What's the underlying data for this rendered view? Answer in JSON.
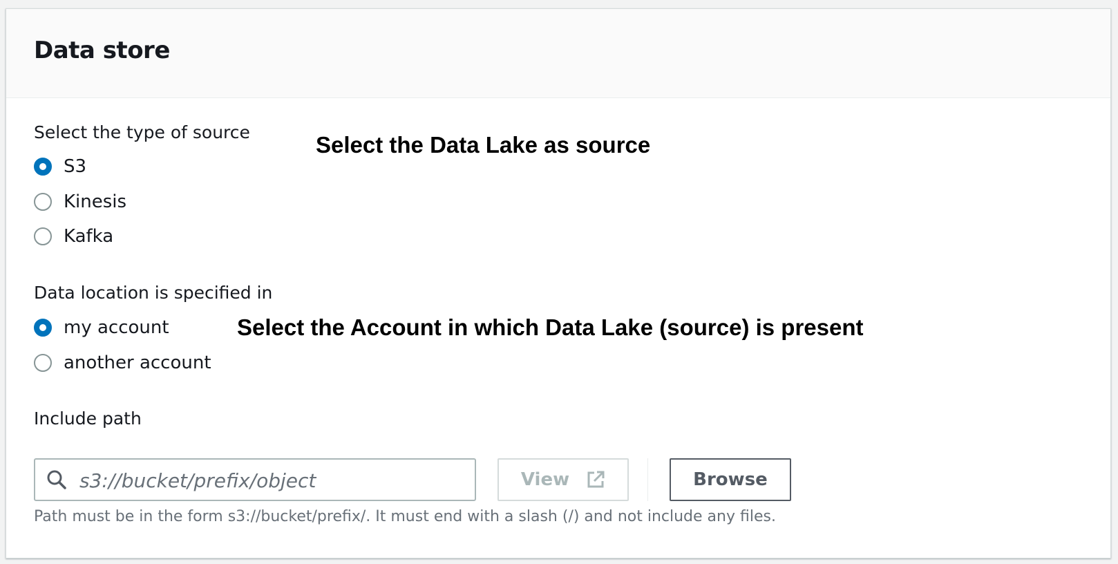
{
  "panel": {
    "title": "Data store"
  },
  "source_type": {
    "label": "Select the type of source",
    "options": [
      {
        "label": "S3",
        "selected": true
      },
      {
        "label": "Kinesis",
        "selected": false
      },
      {
        "label": "Kafka",
        "selected": false
      }
    ]
  },
  "data_location": {
    "label": "Data location is specified in",
    "options": [
      {
        "label": "my account",
        "selected": true
      },
      {
        "label": "another account",
        "selected": false
      }
    ]
  },
  "annotations": {
    "source_note": "Select the Data Lake as source",
    "account_note": "Select the Account in which Data Lake (source) is present"
  },
  "include_path": {
    "label": "Include path",
    "placeholder": "s3://bucket/prefix/object",
    "value": "",
    "view_label": "View",
    "browse_label": "Browse",
    "hint": "Path must be in the form s3://bucket/prefix/. It must end with a slash (/) and not include any files."
  },
  "colors": {
    "accent": "#0073bb",
    "text": "#16191f",
    "muted": "#687078",
    "disabled": "#aab7b8"
  },
  "icons": {
    "search": "search-icon",
    "external_link": "external-link-icon"
  }
}
